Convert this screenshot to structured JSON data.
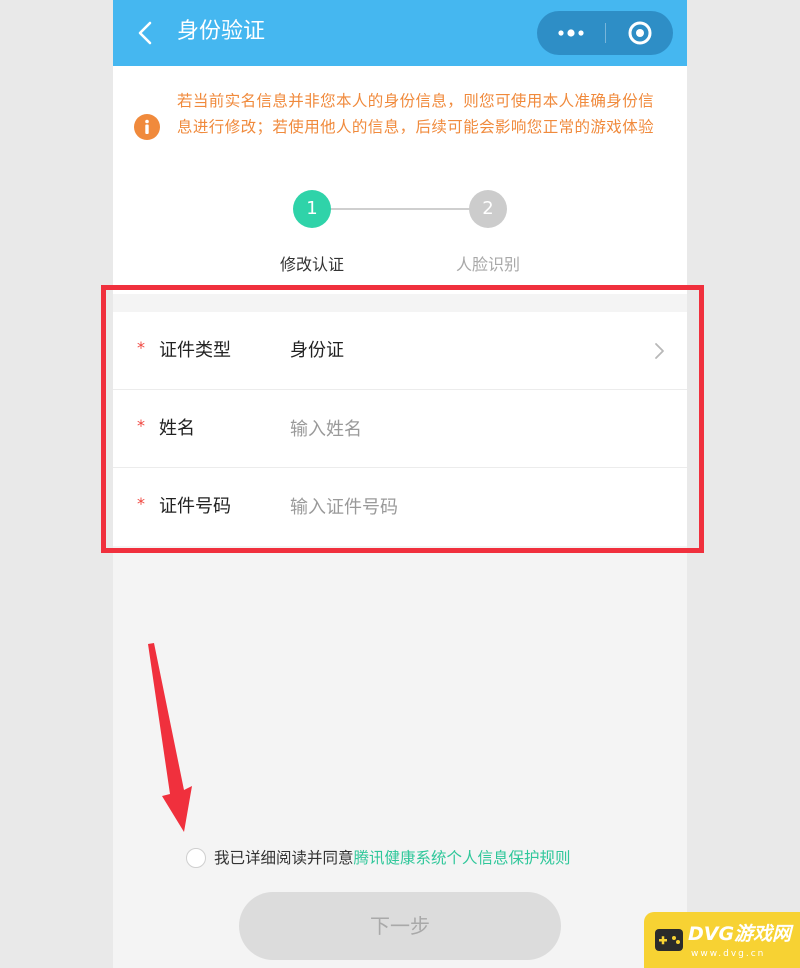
{
  "header": {
    "title": "身份验证",
    "back_icon": "back-chevron-icon",
    "more_icon": "more-dots-icon",
    "close_icon": "target-close-icon",
    "bar_color": "#45b7f0"
  },
  "notice": {
    "icon": "info-icon",
    "text": "若当前实名信息并非您本人的身份信息，则您可使用本人准确身份信息进行修改；若使用他人的信息，后续可能会影响您正常的游戏体验",
    "color": "#f08a3c"
  },
  "steps": [
    {
      "number": "1",
      "label": "修改认证",
      "active": true
    },
    {
      "number": "2",
      "label": "人脸识别",
      "active": false
    }
  ],
  "form": {
    "required_mark": "*",
    "id_type": {
      "label": "证件类型",
      "value": "身份证"
    },
    "name": {
      "label": "姓名",
      "placeholder": "输入姓名"
    },
    "id_number": {
      "label": "证件号码",
      "placeholder": "输入证件号码"
    }
  },
  "agreement": {
    "text": "我已详细阅读并同意",
    "link": "腾讯健康系统个人信息保护规则",
    "checked": false
  },
  "next_button": {
    "label": "下一步"
  },
  "watermark": {
    "title": "DVG游戏网",
    "url": "www.dvg.cn"
  },
  "colors": {
    "accent": "#2fd3a9",
    "link": "#2fc79a",
    "highlight": "#f0303d",
    "required": "#f0463f"
  }
}
